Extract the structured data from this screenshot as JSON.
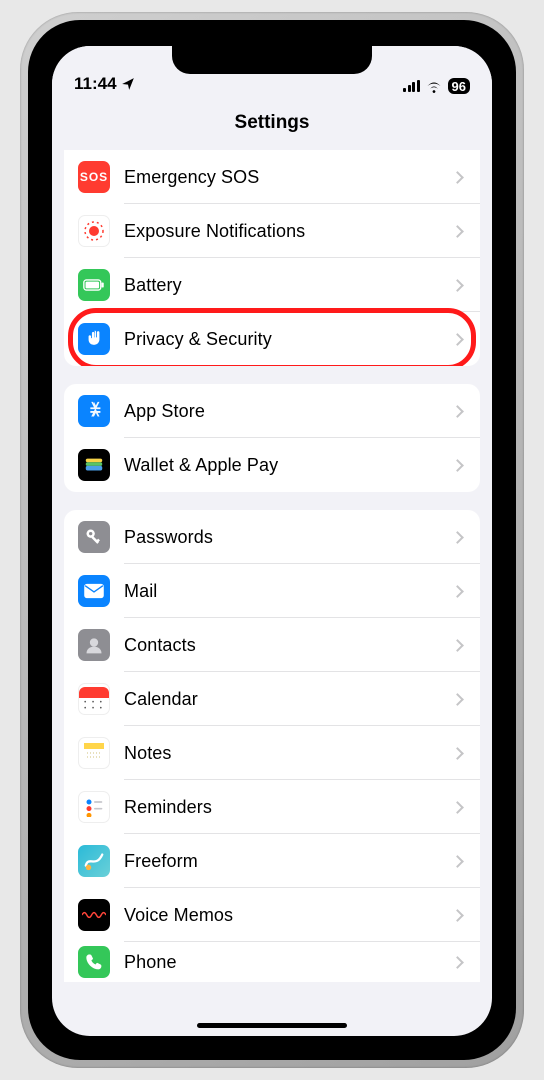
{
  "status": {
    "time": "11:44",
    "battery_pct": "96"
  },
  "header": {
    "title": "Settings"
  },
  "groups": [
    {
      "partial_top": true,
      "items": [
        {
          "id": "emergency-sos",
          "label": "Emergency SOS",
          "icon": "sos-icon",
          "icon_class": "ic-sos"
        },
        {
          "id": "exposure-notifications",
          "label": "Exposure Notifications",
          "icon": "exposure-icon",
          "icon_class": "ic-exposure"
        },
        {
          "id": "battery",
          "label": "Battery",
          "icon": "battery-icon",
          "icon_class": "ic-battery"
        },
        {
          "id": "privacy-security",
          "label": "Privacy & Security",
          "icon": "hand-icon",
          "icon_class": "ic-privacy",
          "highlight": true
        }
      ]
    },
    {
      "items": [
        {
          "id": "app-store",
          "label": "App Store",
          "icon": "appstore-icon",
          "icon_class": "ic-appstore"
        },
        {
          "id": "wallet-apple-pay",
          "label": "Wallet & Apple Pay",
          "icon": "wallet-icon",
          "icon_class": "ic-wallet"
        }
      ]
    },
    {
      "partial_bottom": true,
      "items": [
        {
          "id": "passwords",
          "label": "Passwords",
          "icon": "key-icon",
          "icon_class": "ic-passwords"
        },
        {
          "id": "mail",
          "label": "Mail",
          "icon": "mail-icon",
          "icon_class": "ic-mail"
        },
        {
          "id": "contacts",
          "label": "Contacts",
          "icon": "contacts-icon",
          "icon_class": "ic-contacts"
        },
        {
          "id": "calendar",
          "label": "Calendar",
          "icon": "calendar-icon",
          "icon_class": "ic-calendar"
        },
        {
          "id": "notes",
          "label": "Notes",
          "icon": "notes-icon",
          "icon_class": "ic-notes"
        },
        {
          "id": "reminders",
          "label": "Reminders",
          "icon": "reminders-icon",
          "icon_class": "ic-reminders"
        },
        {
          "id": "freeform",
          "label": "Freeform",
          "icon": "freeform-icon",
          "icon_class": "ic-freeform"
        },
        {
          "id": "voice-memos",
          "label": "Voice Memos",
          "icon": "voicememos-icon",
          "icon_class": "ic-voicememos"
        },
        {
          "id": "phone",
          "label": "Phone",
          "icon": "phone-icon",
          "icon_class": "ic-phone",
          "truncated": true
        }
      ]
    }
  ]
}
